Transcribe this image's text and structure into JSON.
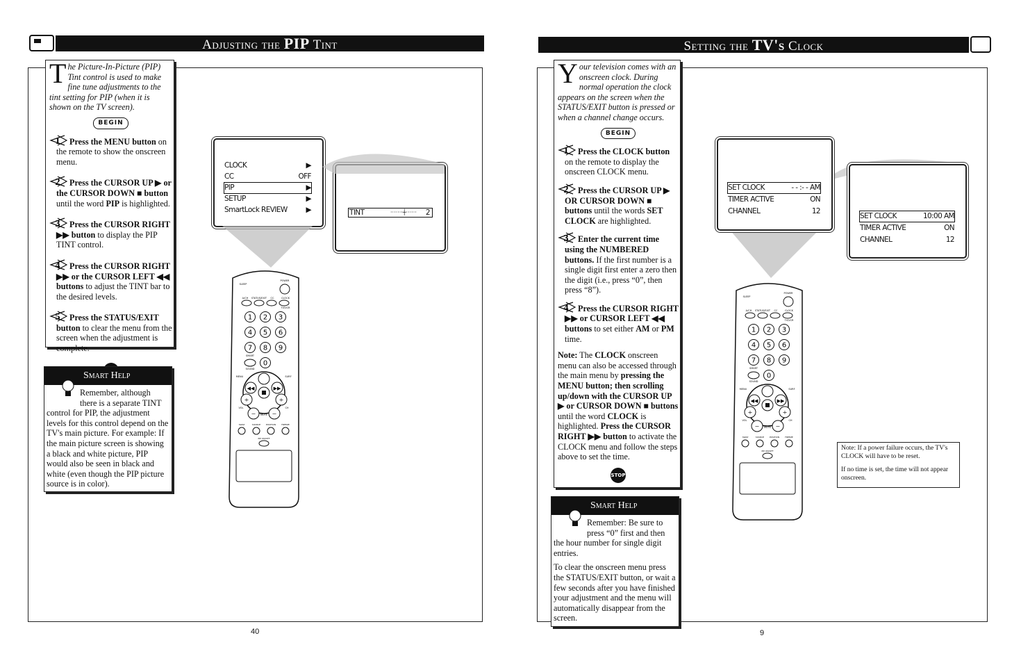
{
  "left": {
    "header_prefix": "Adjusting the ",
    "header_emph": "PIP",
    "header_suffix": " Tint",
    "intro_dropcap": "T",
    "intro": "he Picture-In-Picture (PIP) Tint control is used to make fine tune adjustments to the tint setting for PIP (when it is shown on the TV screen).",
    "begin_label": "BEGIN",
    "steps": [
      {
        "num": "1",
        "segments": [
          {
            "t": "Press the MENU button",
            "b": true
          },
          {
            "t": " on the remote to show the onscreen menu.",
            "b": false
          }
        ]
      },
      {
        "num": "2",
        "segments": [
          {
            "t": "Press the CURSOR UP ▶ or the CURSOR DOWN ■ button",
            "b": true
          },
          {
            "t": " until the word ",
            "b": false
          },
          {
            "t": "PIP",
            "b": true
          },
          {
            "t": " is highlighted.",
            "b": false
          }
        ]
      },
      {
        "num": "3",
        "segments": [
          {
            "t": "Press the CURSOR RIGHT ▶▶ button",
            "b": true
          },
          {
            "t": " to display the PIP TINT control.",
            "b": false
          }
        ]
      },
      {
        "num": "4",
        "segments": [
          {
            "t": "Press the CURSOR RIGHT ▶▶  or the CURSOR LEFT ◀◀ buttons",
            "b": true
          },
          {
            "t": "  to adjust the TINT bar to the desired levels.",
            "b": false
          }
        ]
      },
      {
        "num": "5",
        "segments": [
          {
            "t": "Press the STATUS/EXIT button",
            "b": true
          },
          {
            "t": " to clear the menu from the screen when the adjustment is complete.",
            "b": false
          }
        ]
      }
    ],
    "stop_label": "STOP",
    "smart_help_title": "Smart Help",
    "smart_help": [
      "Remember, although there is a separate TINT control for PIP, the adjustment levels for this control depend on the TV's main picture. For example: If the main picture screen is showing a black and white picture, PIP would also be seen in black and white (even though the PIP picture source is in color)."
    ],
    "menu": [
      {
        "label": "CLOCK",
        "value": "▶",
        "highlighted": false
      },
      {
        "label": "CC",
        "value": "OFF",
        "highlighted": false
      },
      {
        "label": "PIP",
        "value": "▶",
        "highlighted": true
      },
      {
        "label": "SETUP",
        "value": "▶",
        "highlighted": false
      },
      {
        "label": "SmartLock REVIEW",
        "value": "▶",
        "highlighted": false
      }
    ],
    "tint": {
      "label": "TINT",
      "value": "2"
    },
    "callouts": [
      "5",
      "1",
      "2",
      "3",
      "4"
    ],
    "page_number": "40"
  },
  "right": {
    "header_prefix": "Setting the ",
    "header_emph": "TV's",
    "header_suffix": " Clock",
    "intro_dropcap": "Y",
    "intro": "our television comes with an onscreen clock. During normal operation the clock appears on the screen when the STATUS/EXIT button is pressed or when a channel change occurs.",
    "begin_label": "BEGIN",
    "steps": [
      {
        "num": "1",
        "segments": [
          {
            "t": "Press the CLOCK button",
            "b": true
          },
          {
            "t": " on the remote to display the onscreen CLOCK menu.",
            "b": false
          }
        ]
      },
      {
        "num": "2",
        "segments": [
          {
            "t": "Press the CURSOR UP ▶ OR CURSOR DOWN ■ buttons",
            "b": true
          },
          {
            "t": " until the words ",
            "b": false
          },
          {
            "t": "SET CLOCK",
            "b": true
          },
          {
            "t": " are highlighted.",
            "b": false
          }
        ]
      },
      {
        "num": "3",
        "segments": [
          {
            "t": "Enter the current time using the NUMBERED buttons.",
            "b": true
          },
          {
            "t": " If the first number is a single digit first enter a zero then the digit (i.e., press “0”, then press “8”).",
            "b": false
          }
        ]
      },
      {
        "num": "4",
        "segments": [
          {
            "t": "Press the CURSOR RIGHT ▶▶ or CURSOR LEFT ◀◀ buttons",
            "b": true
          },
          {
            "t": " to set either ",
            "b": false
          },
          {
            "t": "AM",
            "b": true
          },
          {
            "t": " or ",
            "b": false
          },
          {
            "t": "PM",
            "b": true
          },
          {
            "t": " time.",
            "b": false
          }
        ]
      }
    ],
    "note": [
      {
        "t": "Note:",
        "b": true
      },
      {
        "t": " The ",
        "b": false
      },
      {
        "t": "CLOCK",
        "b": true
      },
      {
        "t": " onscreen menu can also be accessed through the main menu by ",
        "b": false
      },
      {
        "t": "pressing the MENU button; then scrolling up/down with the CURSOR UP ▶ or CURSOR DOWN ■ buttons",
        "b": true
      },
      {
        "t": " until the word ",
        "b": false
      },
      {
        "t": "CLOCK",
        "b": true
      },
      {
        "t": " is highlighted. ",
        "b": false
      },
      {
        "t": "Press the CURSOR RIGHT ▶▶ button",
        "b": true
      },
      {
        "t": " to activate the CLOCK menu and follow the steps above to set the time.",
        "b": false
      }
    ],
    "stop_label": "STOP",
    "smart_help_title": "Smart Help",
    "smart_help": [
      "Remember: Be sure to press “0” first and then the hour number for single digit entries.",
      "To clear the onscreen menu press the STATUS/EXIT button, or wait a few seconds after you have finished your adjustment and the menu will automatically disappear from the screen."
    ],
    "clock_menu_before": [
      {
        "label": "SET CLOCK",
        "value": "- - :- -  AM",
        "highlighted": true
      },
      {
        "label": "TIMER ACTIVE",
        "value": "ON",
        "highlighted": false
      },
      {
        "label": "CHANNEL",
        "value": "12",
        "highlighted": false
      }
    ],
    "clock_menu_after": [
      {
        "label": "SET CLOCK",
        "value": "10:00  AM",
        "highlighted": true
      },
      {
        "label": "TIMER ACTIVE",
        "value": "ON",
        "highlighted": false
      },
      {
        "label": "CHANNEL",
        "value": "12",
        "highlighted": false
      }
    ],
    "side_note": [
      "Note: If a power failure occurs, the TV's CLOCK will have to be reset.",
      "If no time is set, the time will not appear onscreen."
    ],
    "callouts": [
      "1",
      "3",
      "2",
      "4"
    ],
    "page_number": "9"
  },
  "remote": {
    "labels": {
      "power": "POWER",
      "sleep": "SLEEP",
      "ach": "A/CH",
      "status": "STATUS/EXIT",
      "cc": "CC",
      "clock": "CLOCK",
      "tvvcr": "TV/VCR",
      "vol": "VOL",
      "ch": "CH",
      "mute": "MUTE",
      "menu": "MENU",
      "surf": "SURF",
      "sound": "SOUND",
      "smart": "SMART",
      "swap": "SWAP",
      "source": "SOURCE",
      "position": "POSITION",
      "freeze": "FREEZE",
      "pip": "PIP ON/OFF"
    },
    "digits": [
      "1",
      "2",
      "3",
      "4",
      "5",
      "6",
      "7",
      "8",
      "9",
      "0"
    ]
  },
  "colors": {
    "ink": "#111111",
    "paper": "#ffffff",
    "halftone": "#b8b8b8"
  }
}
